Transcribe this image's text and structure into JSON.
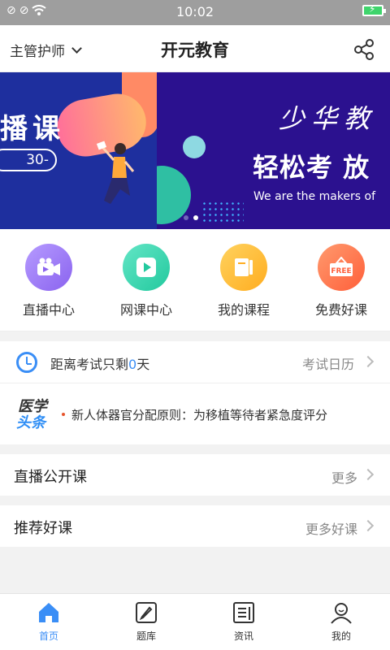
{
  "status_bar": {
    "time": "10:02"
  },
  "header": {
    "role": "主管护师",
    "title": "开元教育"
  },
  "banner": {
    "left_big_text": "播课",
    "left_pill_text": "30-",
    "right_calligraphy": "少华教",
    "right_headline": "轻松考 放",
    "right_subtitle": "We are the makers of"
  },
  "quick_nav": [
    {
      "label": "直播中心",
      "icon": "live-camera-icon",
      "color": "#9b7cf4"
    },
    {
      "label": "网课中心",
      "icon": "play-icon",
      "color": "#3fd8b5"
    },
    {
      "label": "我的课程",
      "icon": "book-icon",
      "color": "#ffc23b"
    },
    {
      "label": "免费好课",
      "icon": "free-icon",
      "color": "#ff7a4d"
    }
  ],
  "exam": {
    "prefix": "距离考试只剩",
    "days": "0",
    "suffix": "天",
    "calendar_link": "考试日历"
  },
  "news": {
    "logo_top": "医学",
    "logo_bottom": "头条",
    "headline": "新人体器官分配原则：为移植等待者紧急度评分"
  },
  "sections": [
    {
      "title": "直播公开课",
      "more": "更多"
    },
    {
      "title": "推荐好课",
      "more": "更多好课"
    }
  ],
  "tab_bar": [
    {
      "label": "首页",
      "icon": "home-icon",
      "active": true
    },
    {
      "label": "题库",
      "icon": "pencil-icon",
      "active": false
    },
    {
      "label": "资讯",
      "icon": "news-icon",
      "active": false
    },
    {
      "label": "我的",
      "icon": "user-icon",
      "active": false
    }
  ],
  "colors": {
    "accent": "#3a8ef6",
    "banner_bg": "#2b118f"
  }
}
